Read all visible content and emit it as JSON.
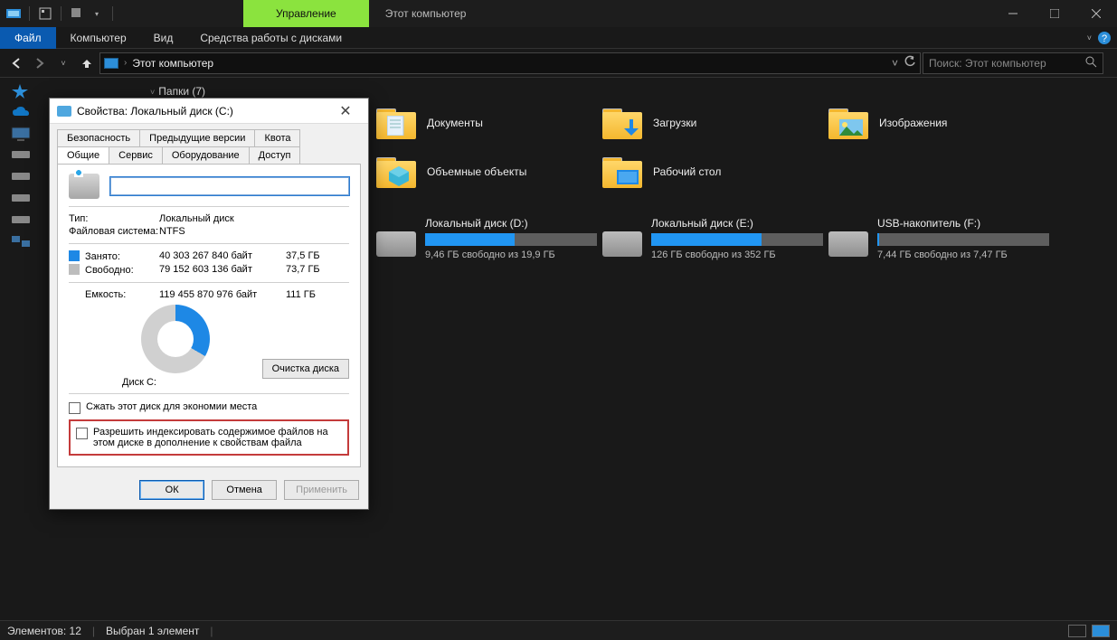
{
  "titlebar": {
    "context_tab": "Управление",
    "title": "Этот компьютер"
  },
  "menubar": {
    "file": "Файл",
    "computer": "Компьютер",
    "view": "Вид",
    "drive_tools": "Средства работы с дисками"
  },
  "navbar": {
    "breadcrumb": "Этот компьютер",
    "search_placeholder": "Поиск: Этот компьютер"
  },
  "main": {
    "folders_header": "Папки (7)",
    "folders": [
      {
        "label": "Документы"
      },
      {
        "label": "Загрузки"
      },
      {
        "label": "Изображения"
      },
      {
        "label": "Объемные объекты"
      },
      {
        "label": "Рабочий стол"
      }
    ],
    "drives": [
      {
        "name": "Локальный диск (D:)",
        "free_text": "9,46 ГБ свободно из 19,9 ГБ",
        "fill_pct": 52
      },
      {
        "name": "Локальный диск (E:)",
        "free_text": "126 ГБ свободно из 352 ГБ",
        "fill_pct": 64
      },
      {
        "name": "USB-накопитель (F:)",
        "free_text": "7,44 ГБ свободно из 7,47 ГБ",
        "fill_pct": 1
      }
    ]
  },
  "statusbar": {
    "count": "Элементов: 12",
    "selection": "Выбран 1 элемент"
  },
  "dialog": {
    "title": "Свойства: Локальный диск (C:)",
    "tabs_row1": [
      "Безопасность",
      "Предыдущие версии",
      "Квота"
    ],
    "tabs_row2": [
      "Общие",
      "Сервис",
      "Оборудование",
      "Доступ"
    ],
    "active_tab": "Общие",
    "name_value": "",
    "type_label": "Тип:",
    "type_value": "Локальный диск",
    "fs_label": "Файловая система:",
    "fs_value": "NTFS",
    "used_label": "Занято:",
    "used_bytes": "40 303 267 840 байт",
    "used_hr": "37,5 ГБ",
    "free_label": "Свободно:",
    "free_bytes": "79 152 603 136 байт",
    "free_hr": "73,7 ГБ",
    "cap_label": "Емкость:",
    "cap_bytes": "119 455 870 976 байт",
    "cap_hr": "111 ГБ",
    "disk_label": "Диск C:",
    "cleanup_btn": "Очистка диска",
    "compress_chk": "Сжать этот диск для экономии места",
    "index_chk": "Разрешить индексировать содержимое файлов на этом диске в дополнение к свойствам файла",
    "ok": "ОК",
    "cancel": "Отмена",
    "apply": "Применить"
  }
}
